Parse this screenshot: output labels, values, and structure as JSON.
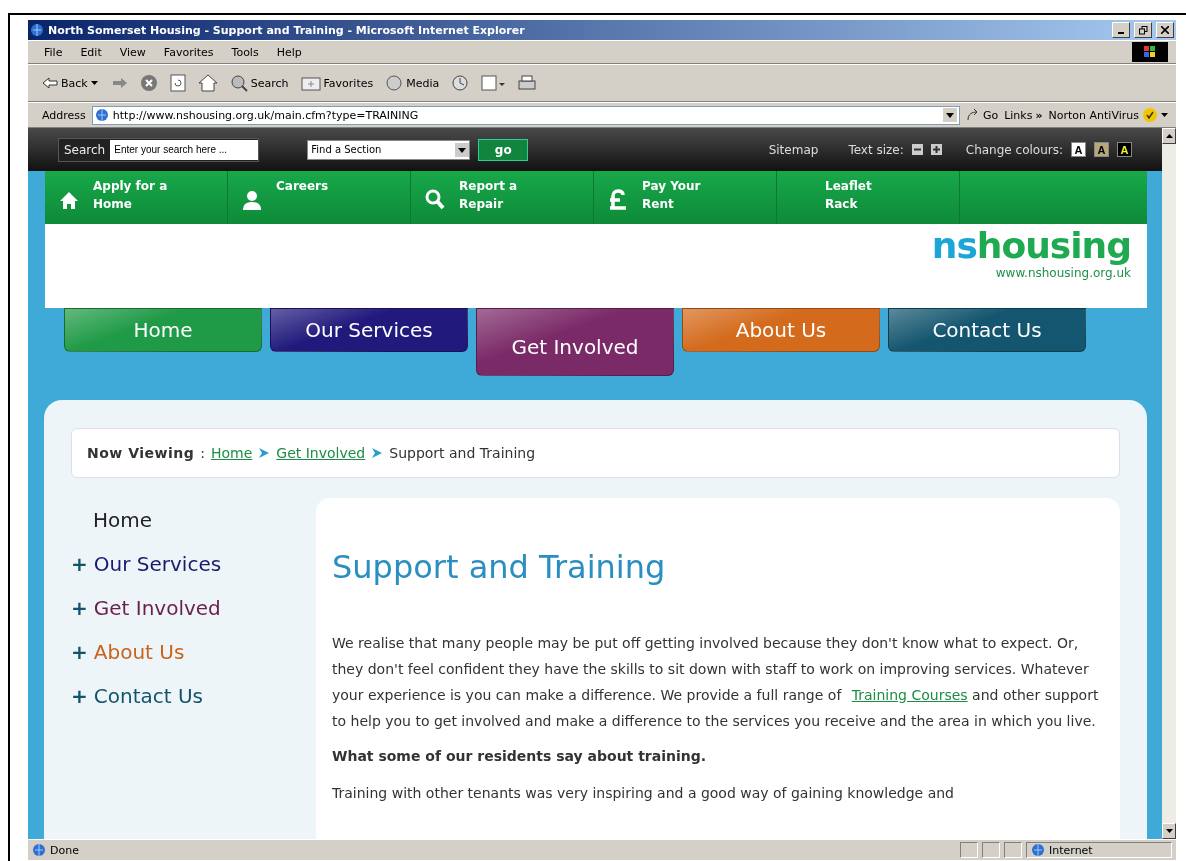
{
  "window": {
    "title": "North Somerset Housing - Support and Training - Microsoft Internet Explorer"
  },
  "menu": [
    "File",
    "Edit",
    "View",
    "Favorites",
    "Tools",
    "Help"
  ],
  "toolbar": {
    "back": "Back",
    "search": "Search",
    "favorites": "Favorites",
    "media": "Media"
  },
  "address": {
    "label": "Address",
    "url": "http://www.nshousing.org.uk/main.cfm?type=TRAINING",
    "go": "Go",
    "links": "Links",
    "links_more": "»",
    "norton": "Norton AntiVirus"
  },
  "site": {
    "topbar": {
      "search_label": "Search",
      "search_placeholder": "Enter your search here ...",
      "section_select": "Find a Section",
      "go": "go",
      "sitemap": "Sitemap",
      "text_size": "Text size:",
      "change_colours": "Change colours:",
      "colour_buttons": [
        {
          "label": "A",
          "color": "#ffffff"
        },
        {
          "label": "A",
          "color": "#b8a77a"
        },
        {
          "label": "A",
          "color": "#000000"
        }
      ]
    },
    "quicklinks": [
      {
        "kind": "home",
        "label": "Apply for a Home"
      },
      {
        "kind": "person",
        "label": "Careers"
      },
      {
        "kind": "search",
        "label": "Report a Repair"
      },
      {
        "kind": "pound",
        "label": "Pay Your Rent"
      },
      {
        "kind": "none",
        "label": "Leaflet Rack"
      }
    ],
    "logo": {
      "brand_a": "ns",
      "brand_b": "housing",
      "url": "www.nshousing.org.uk"
    },
    "tabs": [
      {
        "label": "Home",
        "color": "#1f9a46",
        "selected": false
      },
      {
        "label": "Our Services",
        "color": "#211a7c",
        "selected": false
      },
      {
        "label": "Get Involved",
        "color": "#7b2a68",
        "selected": true
      },
      {
        "label": "About Us",
        "color": "#d46a1c",
        "selected": false
      },
      {
        "label": "Contact Us",
        "color": "#14566f",
        "selected": false
      }
    ],
    "breadcrumb": {
      "label": "Now Viewing",
      "separator": ":",
      "links": [
        "Home",
        "Get Involved"
      ],
      "current": "Support and Training"
    },
    "sidebar": [
      {
        "label": "Home",
        "color": "#222222"
      },
      {
        "prefix": "+",
        "label": "Our Services",
        "color": "#1b1a6e"
      },
      {
        "prefix": "+",
        "label": "Get Involved",
        "color": "#6b1f4e"
      },
      {
        "prefix": "+",
        "label": "About Us",
        "color": "#c8631a"
      },
      {
        "prefix": "+",
        "label": "Contact Us",
        "color": "#12546c"
      }
    ],
    "article": {
      "title": "Support and Training",
      "intro_before": "We realise that many people may be put off getting involved because they don't know what to expect. Or, they don't feel confident they have the skills to sit down with staff to work on improving services.  Whatever your experience is you can make a difference. We provide a full range of ",
      "intro_link": "Training Courses",
      "intro_after": " and other support to help you to get involved and make a difference to the services you receive and the area in which you live.",
      "subheading": "What some of our residents say about training.",
      "quote": "Training with other tenants was very inspiring and a good way of gaining knowledge and"
    }
  },
  "status_bar": {
    "text": "Done",
    "zone": "Internet"
  }
}
